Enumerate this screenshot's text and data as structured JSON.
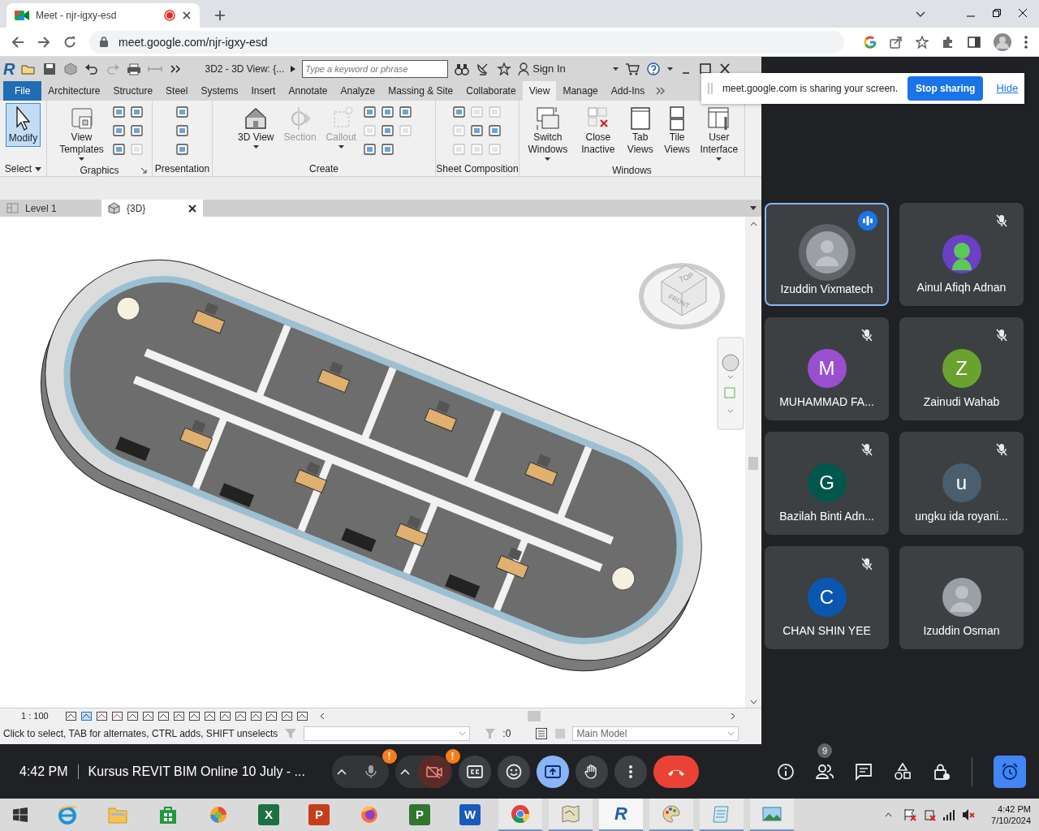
{
  "browser": {
    "tab_title": "Meet - njr-igxy-esd",
    "recording": true,
    "url": "meet.google.com/njr-igxy-esd"
  },
  "revit": {
    "logo": "R",
    "title": "3D2 - 3D View: {...",
    "search": {
      "placeholder": "Type a keyword or phrase"
    },
    "sign_in": "Sign In",
    "ribbon_tabs": [
      {
        "label": "File",
        "kind": "file",
        "selected": false
      },
      {
        "label": "Architecture",
        "kind": "tab",
        "selected": false
      },
      {
        "label": "Structure",
        "kind": "tab",
        "selected": false
      },
      {
        "label": "Steel",
        "kind": "tab",
        "selected": false
      },
      {
        "label": "Systems",
        "kind": "tab",
        "selected": false
      },
      {
        "label": "Insert",
        "kind": "tab",
        "selected": false
      },
      {
        "label": "Annotate",
        "kind": "tab",
        "selected": false
      },
      {
        "label": "Analyze",
        "kind": "tab",
        "selected": false
      },
      {
        "label": "Massing & Site",
        "kind": "tab",
        "selected": false
      },
      {
        "label": "Collaborate",
        "kind": "tab",
        "selected": false
      },
      {
        "label": "View",
        "kind": "tab",
        "selected": true
      },
      {
        "label": "Manage",
        "kind": "tab",
        "selected": false
      },
      {
        "label": "Add-Ins",
        "kind": "tab",
        "selected": false
      }
    ],
    "panels": [
      {
        "title": "Select",
        "title_dropdown": true,
        "tools": [
          {
            "kind": "large",
            "label": "Modify",
            "selected": true,
            "disabled": false,
            "dropdown": false
          }
        ]
      },
      {
        "title": "Graphics",
        "launcher": true,
        "tools": [
          {
            "kind": "large",
            "label": "View Templates",
            "selected": false,
            "disabled": false,
            "dropdown": true
          },
          {
            "kind": "small",
            "disabled": false
          },
          {
            "kind": "small",
            "disabled": false
          },
          {
            "kind": "small",
            "disabled": false
          },
          {
            "kind": "small",
            "disabled": false
          },
          {
            "kind": "small",
            "disabled": false
          },
          {
            "kind": "small",
            "disabled": true
          }
        ]
      },
      {
        "title": "Presentation",
        "tools": [
          {
            "kind": "small",
            "disabled": false
          },
          {
            "kind": "small",
            "disabled": false
          },
          {
            "kind": "small",
            "disabled": false
          }
        ]
      },
      {
        "title": "Create",
        "tools": [
          {
            "kind": "large",
            "label": "3D View",
            "selected": false,
            "disabled": false,
            "dropdown": true
          },
          {
            "kind": "large",
            "label": "Section",
            "selected": false,
            "disabled": true,
            "dropdown": false
          },
          {
            "kind": "large",
            "label": "Callout",
            "selected": false,
            "disabled": true,
            "dropdown": true
          },
          {
            "kind": "small",
            "disabled": false
          },
          {
            "kind": "small",
            "disabled": true
          },
          {
            "kind": "small",
            "disabled": false
          },
          {
            "kind": "small",
            "disabled": false
          },
          {
            "kind": "small",
            "disabled": false
          },
          {
            "kind": "small",
            "disabled": false
          },
          {
            "kind": "small",
            "disabled": false
          },
          {
            "kind": "small",
            "disabled": true
          }
        ]
      },
      {
        "title": "Sheet Composition",
        "tools": [
          {
            "kind": "small",
            "disabled": false
          },
          {
            "kind": "small",
            "disabled": true
          },
          {
            "kind": "small",
            "disabled": true
          },
          {
            "kind": "small",
            "disabled": true
          },
          {
            "kind": "small",
            "disabled": false
          },
          {
            "kind": "small",
            "disabled": true
          },
          {
            "kind": "small",
            "disabled": true
          },
          {
            "kind": "small",
            "disabled": false
          },
          {
            "kind": "small",
            "disabled": true
          }
        ]
      },
      {
        "title": "Windows",
        "tools": [
          {
            "kind": "large",
            "label": "Switch Windows",
            "selected": false,
            "disabled": false,
            "dropdown": true
          },
          {
            "kind": "large",
            "label": "Close Inactive",
            "selected": false,
            "disabled": false,
            "dropdown": false
          },
          {
            "kind": "large",
            "label": "Tab Views",
            "selected": false,
            "disabled": false,
            "dropdown": false
          },
          {
            "kind": "large",
            "label": "Tile Views",
            "selected": false,
            "disabled": false,
            "dropdown": false
          },
          {
            "kind": "large",
            "label": "User Interface",
            "selected": false,
            "disabled": false,
            "dropdown": true
          }
        ]
      }
    ],
    "view_tabs": [
      {
        "label": "Level 1",
        "kind": "plan",
        "selected": false
      },
      {
        "label": "{3D}",
        "kind": "model",
        "selected": true
      }
    ],
    "viewcube": {
      "top": "TOP",
      "front": "FRONT"
    },
    "scale": "1 : 100",
    "status": "Click to select, TAB for alternates, CTRL adds, SHIFT unselects",
    "selection_count": ":0",
    "model": "Main Model"
  },
  "share_banner": {
    "message": "meet.google.com is sharing your screen.",
    "stop": "Stop sharing",
    "hide": "Hide"
  },
  "participants": [
    {
      "name": "Izuddin Vixmatech",
      "kind": "photo",
      "muted": false,
      "speaking": true
    },
    {
      "name": "Ainul Afiqh Adnan",
      "kind": "avatar",
      "muted": true,
      "speaking": false
    },
    {
      "name": "MUHAMMAD FA...",
      "kind": "initial",
      "initial": "M",
      "color": "#9a4fd1",
      "muted": true,
      "speaking": false
    },
    {
      "name": "Zainudi Wahab",
      "kind": "initial",
      "initial": "Z",
      "color": "#6aa22f",
      "muted": true,
      "speaking": false
    },
    {
      "name": "Bazilah Binti Adn...",
      "kind": "initial",
      "initial": "G",
      "color": "#00574b",
      "muted": true,
      "speaking": false
    },
    {
      "name": "ungku ida royani...",
      "kind": "initial",
      "initial": "u",
      "color": "#4b5e6d",
      "muted": true,
      "speaking": false
    },
    {
      "name": "CHAN SHIN YEE",
      "kind": "initial",
      "initial": "C",
      "color": "#0b57b0",
      "muted": true,
      "speaking": false
    },
    {
      "name": "Izuddin Osman",
      "kind": "photo",
      "muted": false,
      "speaking": false
    }
  ],
  "meeting": {
    "time": "4:42 PM",
    "title": "Kursus REVIT BIM Online 10 July - ...",
    "mic_alert": "!",
    "camera_alert": "!",
    "people_count": "9"
  },
  "taskbar": {
    "apps": [
      {
        "kind": "ie",
        "running": false,
        "selected": false
      },
      {
        "kind": "explorer",
        "running": false,
        "selected": false
      },
      {
        "kind": "store",
        "running": false,
        "selected": false
      },
      {
        "kind": "globe",
        "running": false,
        "selected": false
      },
      {
        "kind": "office",
        "letter": "X",
        "color": "#1d7044",
        "running": false,
        "selected": false
      },
      {
        "kind": "office",
        "letter": "P",
        "color": "#c43e1c",
        "running": false,
        "selected": false
      },
      {
        "kind": "firefox",
        "running": false,
        "selected": false
      },
      {
        "kind": "office",
        "letter": "P",
        "color": "#31752f",
        "running": false,
        "selected": false
      },
      {
        "kind": "office",
        "letter": "W",
        "color": "#185abd",
        "running": false,
        "selected": false
      },
      {
        "kind": "chrome",
        "running": true,
        "selected": false
      },
      {
        "kind": "map",
        "running": true,
        "selected": false
      },
      {
        "kind": "revit",
        "letter": "R",
        "running": true,
        "selected": true
      },
      {
        "kind": "paint",
        "running": true,
        "selected": false
      },
      {
        "kind": "notepad",
        "running": true,
        "selected": false
      },
      {
        "kind": "photos",
        "running": true,
        "selected": false
      }
    ],
    "time": "4:42 PM",
    "date": "7/10/2024"
  }
}
